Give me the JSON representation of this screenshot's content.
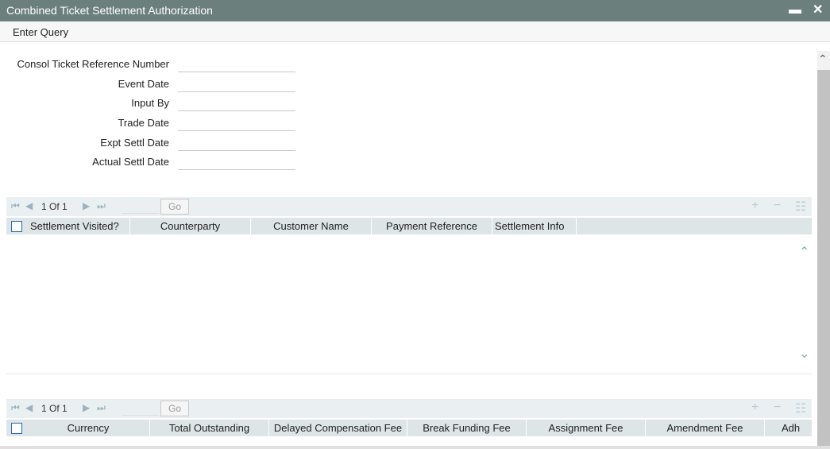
{
  "window": {
    "title": "Combined Ticket Settlement Authorization",
    "minimize_glyph": "▬",
    "close_glyph": "✕"
  },
  "menu": {
    "enter_query": "Enter Query"
  },
  "form": {
    "fields": [
      {
        "label": "Consol Ticket Reference Number",
        "value": ""
      },
      {
        "label": "Event Date",
        "value": ""
      },
      {
        "label": "Input By",
        "value": ""
      },
      {
        "label": "Trade Date",
        "value": ""
      },
      {
        "label": "Expt Settl Date",
        "value": ""
      },
      {
        "label": "Actual Settl Date",
        "value": ""
      }
    ]
  },
  "grid1": {
    "page_info": "1 Of 1",
    "go_label": "Go",
    "columns": [
      "Settlement Visited?",
      "Counterparty",
      "Customer Name",
      "Payment Reference",
      "Settlement Info"
    ]
  },
  "grid2": {
    "page_info": "1 Of 1",
    "go_label": "Go",
    "columns": [
      "Currency",
      "Total Outstanding",
      "Delayed Compensation Fee",
      "Break Funding Fee",
      "Assignment Fee",
      "Amendment Fee",
      "Adh"
    ]
  },
  "icons": {
    "first": "⏮",
    "prev": "◀",
    "next": "▶",
    "last": "⏭",
    "add": "+",
    "remove": "−",
    "columns": "☷",
    "scroll_up": "⌃",
    "scroll_down": "⌄"
  },
  "colors": {
    "titlebar": "#6b7f7d",
    "grid_header": "#dde5e7",
    "pager_bg": "#eaf0f1",
    "checkbox_border": "#2a6bb0"
  }
}
